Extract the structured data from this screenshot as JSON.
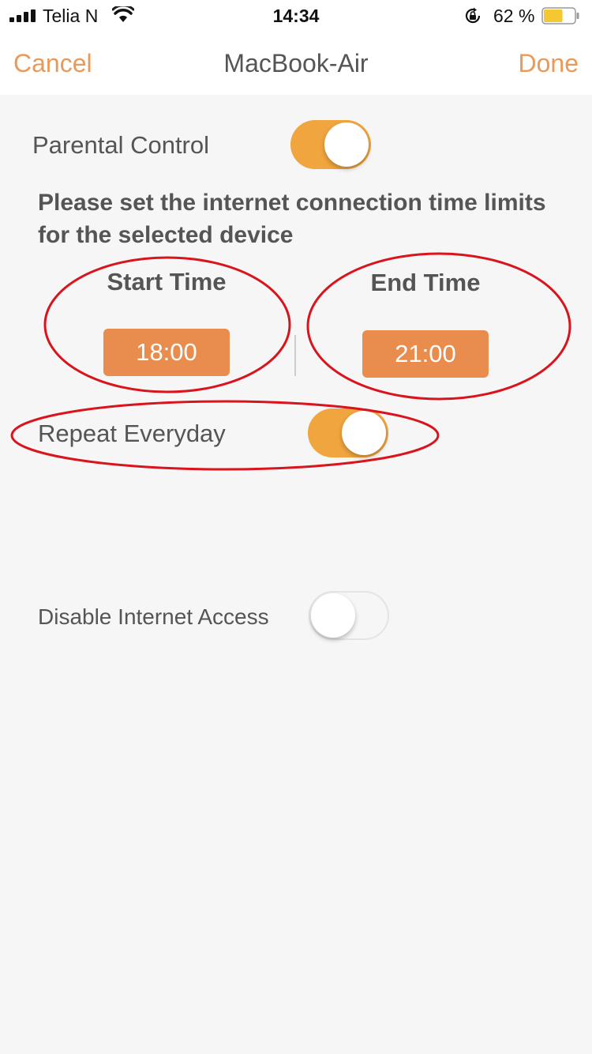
{
  "status_bar": {
    "carrier": "Telia N",
    "time": "14:34",
    "battery_percent": "62 %",
    "signal_icon": "signal-bars-icon",
    "wifi_icon": "wifi-icon",
    "lock_icon": "orientation-lock-icon",
    "battery_icon": "battery-icon",
    "battery_level": 0.62
  },
  "nav": {
    "cancel_label": "Cancel",
    "title": "MacBook-Air",
    "done_label": "Done"
  },
  "parental_control": {
    "label": "Parental Control",
    "enabled": true
  },
  "description": "Please set the internet connection time limits for the selected device",
  "start_time": {
    "heading": "Start Time",
    "value": "18:00"
  },
  "end_time": {
    "heading": "End Time",
    "value": "21:00"
  },
  "repeat_everyday": {
    "label": "Repeat Everyday",
    "enabled": true
  },
  "disable_internet": {
    "label": "Disable Internet Access",
    "enabled": false
  },
  "colors": {
    "accent": "#f0a53e",
    "time_button": "#e98d4f",
    "nav_link": "#e99a5a",
    "annotation": "#d9141c",
    "background": "#f6f6f6"
  }
}
